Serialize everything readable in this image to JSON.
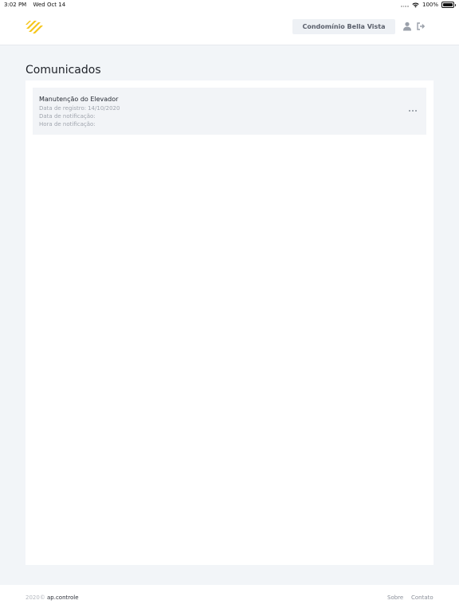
{
  "status_bar": {
    "time": "3:02 PM",
    "date": "Wed Oct 14",
    "battery": "100%"
  },
  "header": {
    "condo_name": "Condomínio Bella Vista",
    "logo_icon": "stripes-logo-icon",
    "accent_color": "#f5c518"
  },
  "main": {
    "title": "Comunicados",
    "notices": [
      {
        "title": "Manutenção do Elevador",
        "registro_label": "Data de registro:",
        "registro_value": "14/10/2020",
        "notificacao_label": "Data de notificação:",
        "notificacao_value": "",
        "hora_label": "Hora de notificação:",
        "hora_value": ""
      }
    ]
  },
  "footer": {
    "copyright": "2020©",
    "brand": "ap.controle",
    "links": [
      "Sobre",
      "Contato"
    ]
  }
}
